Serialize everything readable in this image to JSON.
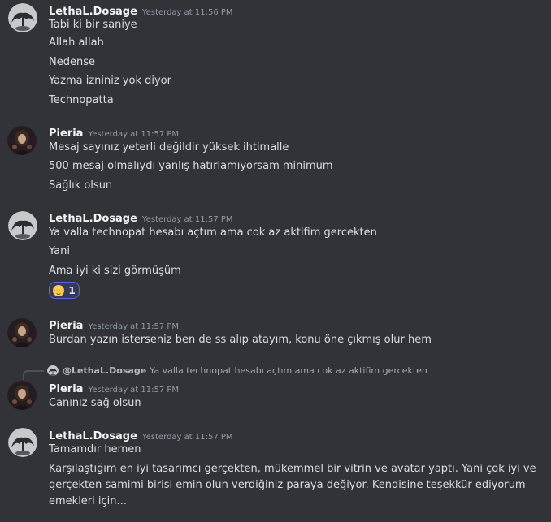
{
  "messages": [
    {
      "author": "LethaL.Dosage",
      "timestamp": "Yesterday at 11:56 PM",
      "lines": [
        "Tabi ki bir saniye",
        "Allah allah",
        "Nedense",
        "Yazma izniniz yok diyor",
        "Technopatta"
      ]
    },
    {
      "author": "Pieria",
      "timestamp": "Yesterday at 11:57 PM",
      "lines": [
        "Mesaj sayınız yeterli değildir yüksek ihtimalle",
        "500 mesaj olmalıydı yanlış hatırlamıyorsam minimum",
        "Sağlık olsun"
      ]
    },
    {
      "author": "LethaL.Dosage",
      "timestamp": "Yesterday at 11:57 PM",
      "lines": [
        "Ya valla technopat hesabı açtım ama cok az aktifim gercekten",
        "Yani",
        "Ama iyi ki sizi görmüşüm"
      ],
      "reaction": {
        "emoji": "relieved-face",
        "count": "1"
      }
    },
    {
      "author": "Pieria",
      "timestamp": "Yesterday at 11:57 PM",
      "lines": [
        "Burdan yazın isterseniz ben de ss alıp atayım, konu öne çıkmış olur hem"
      ]
    },
    {
      "reply_to": {
        "author": "@LethaL.Dosage",
        "text": "Ya valla technopat hesabı açtım ama cok az aktifim gercekten"
      },
      "author": "Pieria",
      "timestamp": "Yesterday at 11:57 PM",
      "lines": [
        "Canınız sağ olsun"
      ]
    },
    {
      "author": "LethaL.Dosage",
      "timestamp": "Yesterday at 11:57 PM",
      "lines": [
        "Tamamdır hemen",
        "Karşılaştığım en iyi tasarımcı gerçekten, mükemmel bir vitrin ve avatar yaptı. Yani çok iyi ve gerçekten samimi birisi emin olun verdiğiniz paraya değiyor. Kendisine teşekkür ediyorum emekleri için..."
      ]
    }
  ],
  "colors": {
    "background": "#313338",
    "text": "#dbdee1",
    "timestamp": "#949ba4",
    "reaction_accent": "#5865f2"
  }
}
